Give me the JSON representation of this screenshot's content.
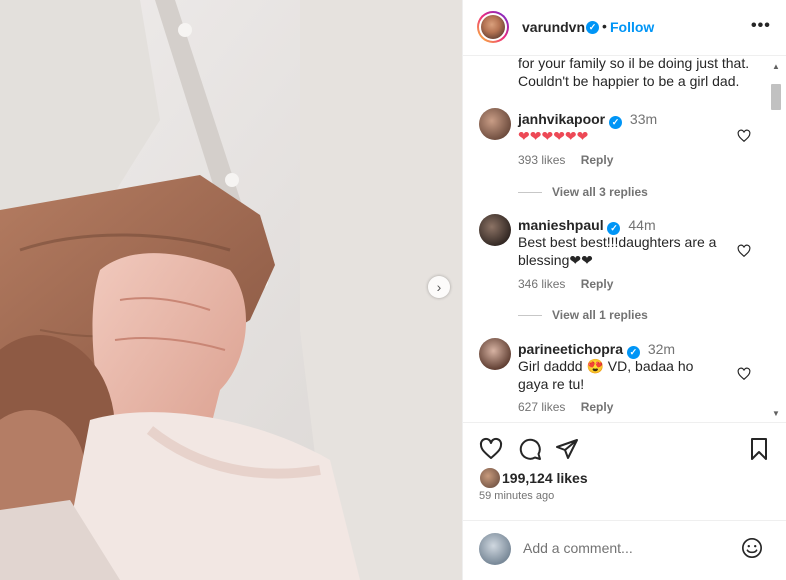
{
  "post": {
    "username": "varundvn",
    "follow_label": "Follow",
    "dot": "•",
    "more": "•••",
    "caption_tail": "for your family so il be doing just that. Couldn't be happier to be a girl dad.",
    "carousel_next": "›"
  },
  "comments": [
    {
      "user": "janhvikapoor",
      "time": "33m",
      "text": "❤❤❤❤❤❤",
      "likes": "393 likes",
      "reply": "Reply",
      "view_replies": "View all 3 replies"
    },
    {
      "user": "manieshpaul",
      "time": "44m",
      "text": "Best best best!!!daughters are a blessing❤❤",
      "likes": "346 likes",
      "reply": "Reply",
      "view_replies": "View all 1 replies"
    },
    {
      "user": "parineetichopra",
      "time": "32m",
      "text": "Girl daddd 😍 VD, badaa ho gaya re tu!",
      "likes": "627 likes",
      "reply": "Reply"
    }
  ],
  "actions": {
    "icons": [
      "heart-icon",
      "comment-icon",
      "share-icon",
      "bookmark-icon"
    ]
  },
  "likes": {
    "count": "199,124 likes"
  },
  "posted_time": "59 minutes ago",
  "add_comment": {
    "placeholder": "Add a comment..."
  },
  "scroll": {
    "up": "▲",
    "down": "▼"
  },
  "colors": {
    "accent": "#0095f6",
    "heart": "#ed4956",
    "muted": "#737373",
    "text": "#262626"
  }
}
